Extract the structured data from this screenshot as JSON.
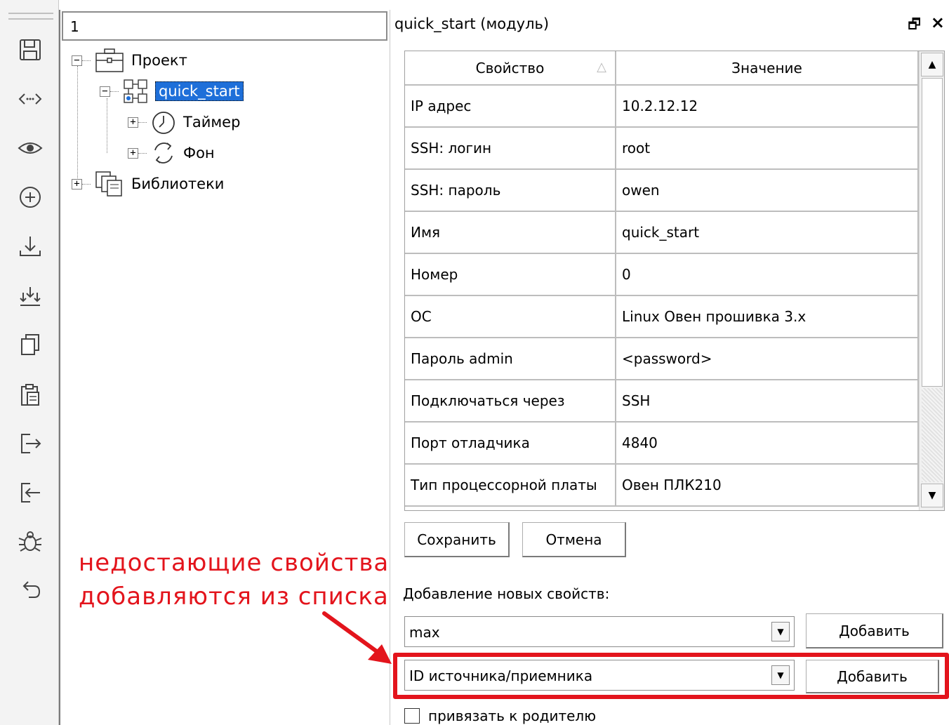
{
  "toolbar": {
    "buttons": [
      {
        "icon": "save-icon"
      },
      {
        "icon": "code-brackets-icon"
      },
      {
        "icon": "eye-icon"
      },
      {
        "icon": "add-circle-icon"
      },
      {
        "icon": "download-icon"
      },
      {
        "icon": "download-all-icon"
      },
      {
        "icon": "copy-icon"
      },
      {
        "icon": "paste-icon"
      },
      {
        "icon": "export-icon"
      },
      {
        "icon": "import-icon"
      },
      {
        "icon": "bug-icon"
      },
      {
        "icon": "undo-icon"
      }
    ]
  },
  "tree": {
    "search_value": "1",
    "nodes": [
      {
        "label": "Проект",
        "icon": "briefcase-icon",
        "expander": "−"
      },
      {
        "label": "quick_start",
        "icon": "module-icon",
        "expander": "−",
        "selected": true
      },
      {
        "label": "Таймер",
        "icon": "timer-icon",
        "expander": "+"
      },
      {
        "label": "Фон",
        "icon": "cycle-icon",
        "expander": "+"
      },
      {
        "label": "Библиотеки",
        "icon": "library-icon",
        "expander": "+"
      }
    ]
  },
  "properties": {
    "title": "quick_start (модуль)",
    "header": {
      "property": "Свойство",
      "value": "Значение"
    },
    "rows": [
      {
        "property": "IP адрес",
        "value": "10.2.12.12"
      },
      {
        "property": "SSH: логин",
        "value": "root"
      },
      {
        "property": "SSH: пароль",
        "value": "owen"
      },
      {
        "property": "Имя",
        "value": "quick_start"
      },
      {
        "property": "Номер",
        "value": "0"
      },
      {
        "property": "ОС",
        "value": "Linux Овен прошивка 3.x"
      },
      {
        "property": "Пароль admin",
        "value": "<password>"
      },
      {
        "property": "Подключаться через",
        "value": "SSH"
      },
      {
        "property": "Порт отладчика",
        "value": "4840"
      },
      {
        "property": "Тип процессорной платы",
        "value": "Овен ПЛК210"
      }
    ],
    "save_label": "Сохранить",
    "cancel_label": "Отмена",
    "add_new_label": "Добавление новых свойств:",
    "combo1_value": "max",
    "combo2_value": "ID источника/приемника",
    "add_label": "Добавить",
    "bind_parent_label": "привязать к родителю"
  },
  "annotation": {
    "line1": "недостающие свойства",
    "line2": "добавляются из списка",
    "color": "#e3141c"
  }
}
